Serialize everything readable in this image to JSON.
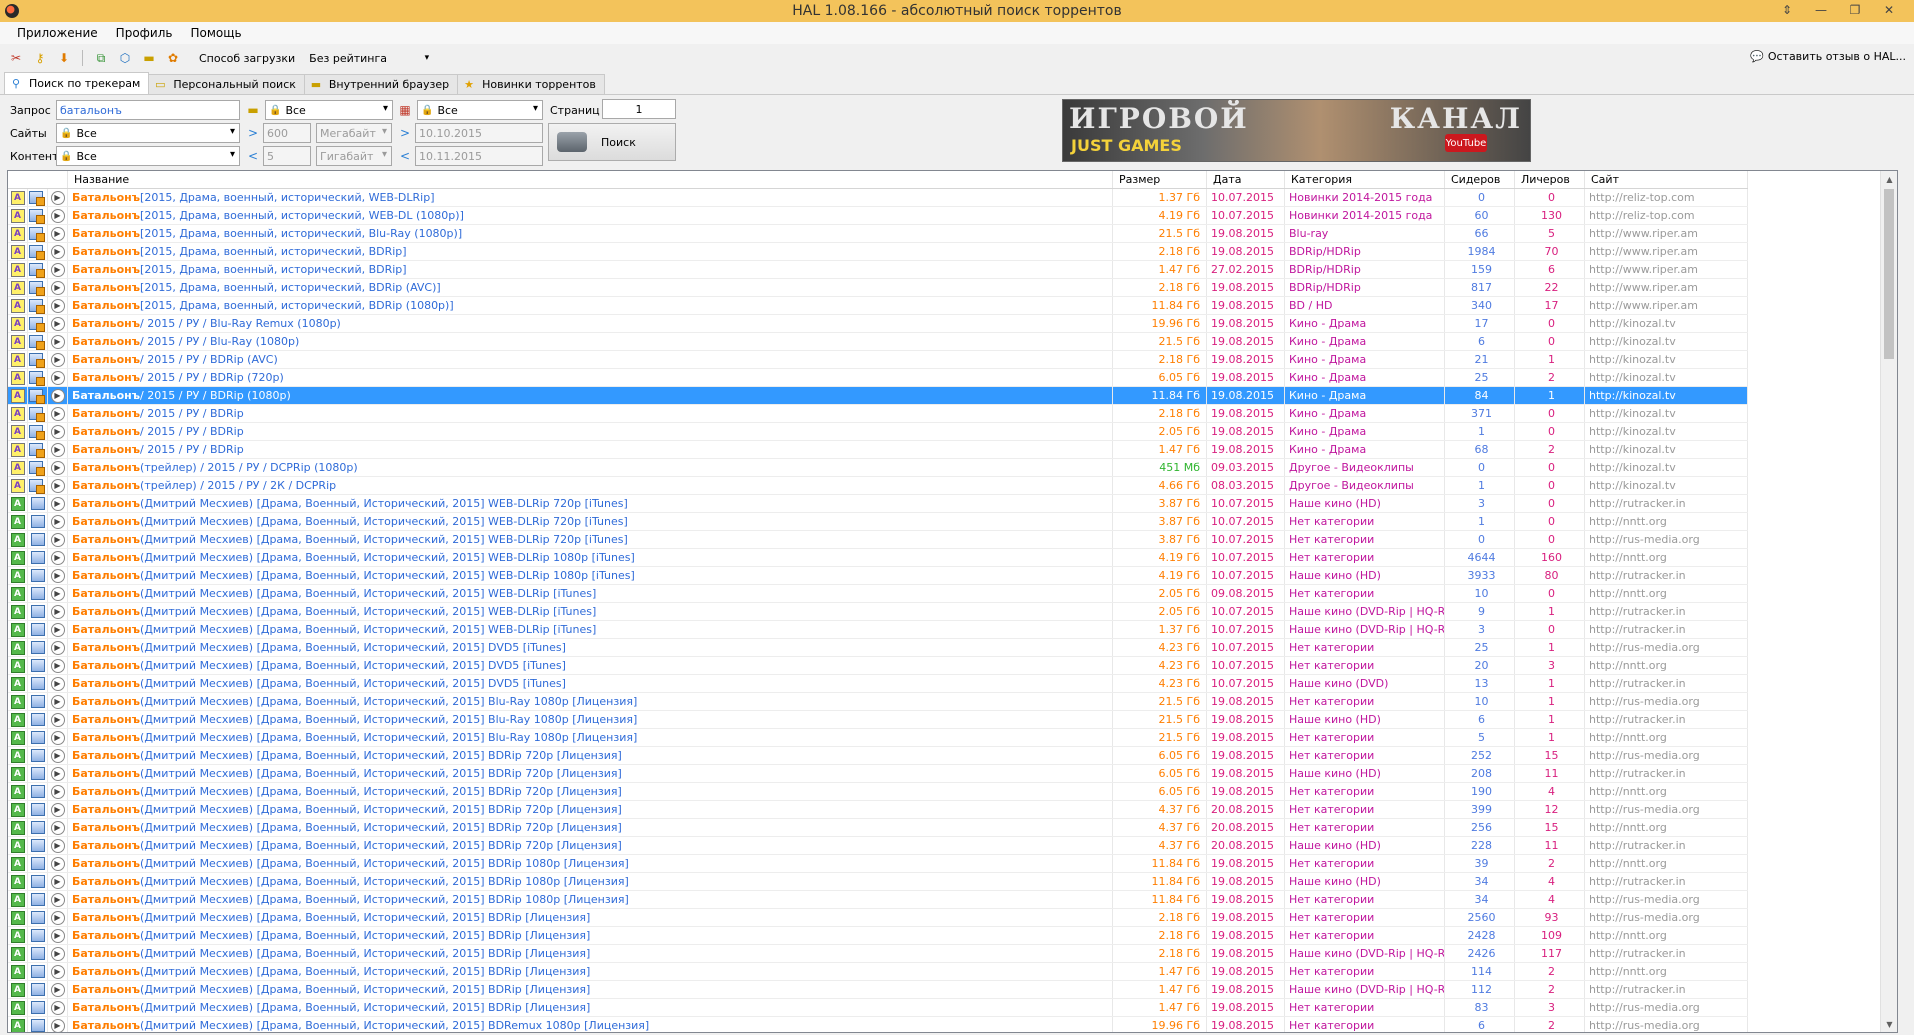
{
  "window": {
    "title": "HAL 1.08.166 - абсолютный поиск торрентов"
  },
  "menu": [
    "Приложение",
    "Профиль",
    "Помощь"
  ],
  "toolbar": {
    "download_method_label": "Способ загрузки",
    "rating_value": "Без рейтинга",
    "review_label": "Оставить отзыв о HAL..."
  },
  "tabs": [
    "Поиск по трекерам",
    "Персональный поиск",
    "Внутренний браузер",
    "Новинки торрентов"
  ],
  "search": {
    "query_label": "Запрос",
    "query_value": "батальонъ",
    "sites_label": "Сайты",
    "sites_value": "Все",
    "content_label": "Контент",
    "content_value": "Все",
    "filter1_value": "Все",
    "filter2_value": "Все",
    "size_min": "600",
    "size_min_unit": "Мегабайт",
    "size_max": "5",
    "size_max_unit": "Гигабайт",
    "date_from": "10.10.2015",
    "date_to": "10.11.2015",
    "pages_label": "Страниц",
    "pages_value": "1",
    "search_button": "Поиск"
  },
  "banner": {
    "line1": "ИГРОВОЙ",
    "line2": "КАНАЛ",
    "line3": "JUST GAMES",
    "badge": "YouTube"
  },
  "table": {
    "columns": [
      "Название",
      "Размер",
      "Дата",
      "Категория",
      "Сидеров",
      "Личеров",
      "Сайт"
    ],
    "rows": [
      {
        "type": "user",
        "q": "Батальонъ",
        "rest": " [2015, Драма, военный, исторический, WEB-DLRip]",
        "size": "1.37 Гб",
        "date": "10.07.2015",
        "cat": "Новинки 2014-2015 года",
        "seeds": "0",
        "leech": "0",
        "site": "http://reliz-top.com"
      },
      {
        "type": "user",
        "q": "Батальонъ",
        "rest": " [2015, Драма, военный, исторический, WEB-DL (1080p)]",
        "size": "4.19 Гб",
        "date": "10.07.2015",
        "cat": "Новинки 2014-2015 года",
        "seeds": "60",
        "leech": "130",
        "site": "http://reliz-top.com"
      },
      {
        "type": "user",
        "q": "Батальонъ",
        "rest": " [2015, Драма, военный, исторический, Blu-Ray (1080p)]",
        "size": "21.5 Гб",
        "date": "19.08.2015",
        "cat": "Blu-ray",
        "seeds": "66",
        "leech": "5",
        "site": "http://www.riper.am"
      },
      {
        "type": "user",
        "q": "Батальонъ",
        "rest": " [2015, Драма, военный, исторический, BDRip]",
        "size": "2.18 Гб",
        "date": "19.08.2015",
        "cat": "BDRip/HDRip",
        "seeds": "1984",
        "leech": "70",
        "site": "http://www.riper.am"
      },
      {
        "type": "user",
        "q": "Батальонъ",
        "rest": " [2015, Драма, военный, исторический, BDRip]",
        "size": "1.47 Гб",
        "date": "27.02.2015",
        "cat": "BDRip/HDRip",
        "seeds": "159",
        "leech": "6",
        "site": "http://www.riper.am"
      },
      {
        "type": "user",
        "q": "Батальонъ",
        "rest": " [2015, Драма, военный, исторический, BDRip (AVC)]",
        "size": "2.18 Гб",
        "date": "19.08.2015",
        "cat": "BDRip/HDRip",
        "seeds": "817",
        "leech": "22",
        "site": "http://www.riper.am"
      },
      {
        "type": "user",
        "q": "Батальонъ",
        "rest": " [2015, Драма, военный, исторический, BDRip (1080p)]",
        "size": "11.84 Гб",
        "date": "19.08.2015",
        "cat": "BD / HD",
        "seeds": "340",
        "leech": "17",
        "site": "http://www.riper.am"
      },
      {
        "type": "user",
        "q": "Батальонъ",
        "rest": " / 2015 / РУ / Blu-Ray Remux (1080p)",
        "size": "19.96 Гб",
        "date": "19.08.2015",
        "cat": "Кино - Драма",
        "seeds": "17",
        "leech": "0",
        "site": "http://kinozal.tv"
      },
      {
        "type": "user",
        "q": "Батальонъ",
        "rest": " / 2015 / РУ / Blu-Ray (1080p)",
        "size": "21.5 Гб",
        "date": "19.08.2015",
        "cat": "Кино - Драма",
        "seeds": "6",
        "leech": "0",
        "site": "http://kinozal.tv"
      },
      {
        "type": "user",
        "q": "Батальонъ",
        "rest": " / 2015 / РУ / BDRip (AVC)",
        "size": "2.18 Гб",
        "date": "19.08.2015",
        "cat": "Кино - Драма",
        "seeds": "21",
        "leech": "1",
        "site": "http://kinozal.tv"
      },
      {
        "type": "user",
        "q": "Батальонъ",
        "rest": " / 2015 / РУ / BDRip (720p)",
        "size": "6.05 Гб",
        "date": "19.08.2015",
        "cat": "Кино - Драма",
        "seeds": "25",
        "leech": "2",
        "site": "http://kinozal.tv"
      },
      {
        "type": "user",
        "sel": true,
        "q": "Батальонъ",
        "rest": " / 2015 / РУ / BDRip (1080p)",
        "size": "11.84 Гб",
        "date": "19.08.2015",
        "cat": "Кино - Драма",
        "seeds": "84",
        "leech": "1",
        "site": "http://kinozal.tv"
      },
      {
        "type": "user",
        "q": "Батальонъ",
        "rest": " / 2015 / РУ / BDRip",
        "size": "2.18 Гб",
        "date": "19.08.2015",
        "cat": "Кино - Драма",
        "seeds": "371",
        "leech": "0",
        "site": "http://kinozal.tv"
      },
      {
        "type": "user",
        "q": "Батальонъ",
        "rest": " / 2015 / РУ / BDRip",
        "size": "2.05 Гб",
        "date": "19.08.2015",
        "cat": "Кино - Драма",
        "seeds": "1",
        "leech": "0",
        "site": "http://kinozal.tv"
      },
      {
        "type": "user",
        "q": "Батальонъ",
        "rest": " / 2015 / РУ / BDRip",
        "size": "1.47 Гб",
        "date": "19.08.2015",
        "cat": "Кино - Драма",
        "seeds": "68",
        "leech": "2",
        "site": "http://kinozal.tv"
      },
      {
        "type": "user",
        "q": "Батальонъ",
        "rest": " (трейлер) / 2015 / РУ / DCPRip (1080p)",
        "size": "451 Мб",
        "green": true,
        "date": "09.03.2015",
        "cat": "Другое - Видеоклипы",
        "seeds": "0",
        "leech": "0",
        "site": "http://kinozal.tv"
      },
      {
        "type": "user",
        "q": "Батальонъ",
        "rest": " (трейлер) / 2015 / РУ / 2К / DCPRip",
        "size": "4.66 Гб",
        "date": "08.03.2015",
        "cat": "Другое - Видеоклипы",
        "seeds": "1",
        "leech": "0",
        "site": "http://kinozal.tv"
      },
      {
        "type": "green",
        "q": "Батальонъ",
        "rest": " (Дмитрий Месхиев) [Драма, Военный, Исторический, 2015] WEB-DLRip 720p [iTunes]",
        "size": "3.87 Гб",
        "date": "10.07.2015",
        "cat": "Наше кино (HD)",
        "seeds": "3",
        "leech": "0",
        "site": "http://rutracker.in"
      },
      {
        "type": "green",
        "q": "Батальонъ",
        "rest": " (Дмитрий Месхиев) [Драма, Военный, Исторический, 2015] WEB-DLRip 720p [iTunes]",
        "size": "3.87 Гб",
        "date": "10.07.2015",
        "cat": "Нет категории",
        "seeds": "1",
        "leech": "0",
        "site": "http://nntt.org"
      },
      {
        "type": "green",
        "q": "Батальонъ",
        "rest": " (Дмитрий Месхиев) [Драма, Военный, Исторический, 2015] WEB-DLRip 720p [iTunes]",
        "size": "3.87 Гб",
        "date": "10.07.2015",
        "cat": "Нет категории",
        "seeds": "0",
        "leech": "0",
        "site": "http://rus-media.org"
      },
      {
        "type": "green",
        "q": "Батальонъ",
        "rest": " (Дмитрий Месхиев) [Драма, Военный, Исторический, 2015] WEB-DLRip 1080p [iTunes]",
        "size": "4.19 Гб",
        "date": "10.07.2015",
        "cat": "Нет категории",
        "seeds": "4644",
        "leech": "160",
        "site": "http://nntt.org"
      },
      {
        "type": "green",
        "q": "Батальонъ",
        "rest": " (Дмитрий Месхиев) [Драма, Военный, Исторический, 2015] WEB-DLRip 1080p [iTunes]",
        "size": "4.19 Гб",
        "date": "10.07.2015",
        "cat": "Наше кино (HD)",
        "seeds": "3933",
        "leech": "80",
        "site": "http://rutracker.in"
      },
      {
        "type": "green",
        "q": "Батальонъ",
        "rest": " (Дмитрий Месхиев) [Драма, Военный, Исторический, 2015] WEB-DLRip [iTunes]",
        "size": "2.05 Гб",
        "date": "09.08.2015",
        "cat": "Нет категории",
        "seeds": "10",
        "leech": "0",
        "site": "http://nntt.org"
      },
      {
        "type": "green",
        "q": "Батальонъ",
        "rest": " (Дмитрий Месхиев) [Драма, Военный, Исторический, 2015] WEB-DLRip [iTunes]",
        "size": "2.05 Гб",
        "date": "10.07.2015",
        "cat": "Наше кино (DVD-Rip | HQ-Ri...",
        "seeds": "9",
        "leech": "1",
        "site": "http://rutracker.in"
      },
      {
        "type": "green",
        "q": "Батальонъ",
        "rest": " (Дмитрий Месхиев) [Драма, Военный, Исторический, 2015] WEB-DLRip [iTunes]",
        "size": "1.37 Гб",
        "date": "10.07.2015",
        "cat": "Наше кино (DVD-Rip | HQ-Ri...",
        "seeds": "3",
        "leech": "0",
        "site": "http://rutracker.in"
      },
      {
        "type": "green",
        "q": "Батальонъ",
        "rest": " (Дмитрий Месхиев) [Драма, Военный, Исторический, 2015] DVD5 [iTunes]",
        "size": "4.23 Гб",
        "date": "10.07.2015",
        "cat": "Нет категории",
        "seeds": "25",
        "leech": "1",
        "site": "http://rus-media.org"
      },
      {
        "type": "green",
        "q": "Батальонъ",
        "rest": " (Дмитрий Месхиев) [Драма, Военный, Исторический, 2015] DVD5 [iTunes]",
        "size": "4.23 Гб",
        "date": "10.07.2015",
        "cat": "Нет категории",
        "seeds": "20",
        "leech": "3",
        "site": "http://nntt.org"
      },
      {
        "type": "green",
        "q": "Батальонъ",
        "rest": " (Дмитрий Месхиев) [Драма, Военный, Исторический, 2015] DVD5 [iTunes]",
        "size": "4.23 Гб",
        "date": "10.07.2015",
        "cat": "Наше кино (DVD)",
        "seeds": "13",
        "leech": "1",
        "site": "http://rutracker.in"
      },
      {
        "type": "green",
        "q": "Батальонъ",
        "rest": " (Дмитрий Месхиев) [Драма, Военный, Исторический, 2015] Blu-Ray 1080p [Лицензия]",
        "size": "21.5 Гб",
        "date": "19.08.2015",
        "cat": "Нет категории",
        "seeds": "10",
        "leech": "1",
        "site": "http://rus-media.org"
      },
      {
        "type": "green",
        "q": "Батальонъ",
        "rest": " (Дмитрий Месхиев) [Драма, Военный, Исторический, 2015] Blu-Ray 1080p [Лицензия]",
        "size": "21.5 Гб",
        "date": "19.08.2015",
        "cat": "Наше кино (HD)",
        "seeds": "6",
        "leech": "1",
        "site": "http://rutracker.in"
      },
      {
        "type": "green",
        "q": "Батальонъ",
        "rest": " (Дмитрий Месхиев) [Драма, Военный, Исторический, 2015] Blu-Ray 1080p [Лицензия]",
        "size": "21.5 Гб",
        "date": "19.08.2015",
        "cat": "Нет категории",
        "seeds": "5",
        "leech": "1",
        "site": "http://nntt.org"
      },
      {
        "type": "green",
        "q": "Батальонъ",
        "rest": " (Дмитрий Месхиев) [Драма, Военный, Исторический, 2015] BDRip 720p [Лицензия]",
        "size": "6.05 Гб",
        "date": "19.08.2015",
        "cat": "Нет категории",
        "seeds": "252",
        "leech": "15",
        "site": "http://rus-media.org"
      },
      {
        "type": "green",
        "q": "Батальонъ",
        "rest": " (Дмитрий Месхиев) [Драма, Военный, Исторический, 2015] BDRip 720p [Лицензия]",
        "size": "6.05 Гб",
        "date": "19.08.2015",
        "cat": "Наше кино (HD)",
        "seeds": "208",
        "leech": "11",
        "site": "http://rutracker.in"
      },
      {
        "type": "green",
        "q": "Батальонъ",
        "rest": " (Дмитрий Месхиев) [Драма, Военный, Исторический, 2015] BDRip 720p [Лицензия]",
        "size": "6.05 Гб",
        "date": "19.08.2015",
        "cat": "Нет категории",
        "seeds": "190",
        "leech": "4",
        "site": "http://nntt.org"
      },
      {
        "type": "green",
        "q": "Батальонъ",
        "rest": " (Дмитрий Месхиев) [Драма, Военный, Исторический, 2015] BDRip 720p [Лицензия]",
        "size": "4.37 Гб",
        "date": "20.08.2015",
        "cat": "Нет категории",
        "seeds": "399",
        "leech": "12",
        "site": "http://rus-media.org"
      },
      {
        "type": "green",
        "q": "Батальонъ",
        "rest": " (Дмитрий Месхиев) [Драма, Военный, Исторический, 2015] BDRip 720p [Лицензия]",
        "size": "4.37 Гб",
        "date": "20.08.2015",
        "cat": "Нет категории",
        "seeds": "256",
        "leech": "15",
        "site": "http://nntt.org"
      },
      {
        "type": "green",
        "q": "Батальонъ",
        "rest": " (Дмитрий Месхиев) [Драма, Военный, Исторический, 2015] BDRip 720p [Лицензия]",
        "size": "4.37 Гб",
        "date": "20.08.2015",
        "cat": "Наше кино (HD)",
        "seeds": "228",
        "leech": "11",
        "site": "http://rutracker.in"
      },
      {
        "type": "green",
        "q": "Батальонъ",
        "rest": " (Дмитрий Месхиев) [Драма, Военный, Исторический, 2015] BDRip 1080p [Лицензия]",
        "size": "11.84 Гб",
        "date": "19.08.2015",
        "cat": "Нет категории",
        "seeds": "39",
        "leech": "2",
        "site": "http://nntt.org"
      },
      {
        "type": "green",
        "q": "Батальонъ",
        "rest": " (Дмитрий Месхиев) [Драма, Военный, Исторический, 2015] BDRip 1080p [Лицензия]",
        "size": "11.84 Гб",
        "date": "19.08.2015",
        "cat": "Наше кино (HD)",
        "seeds": "34",
        "leech": "4",
        "site": "http://rutracker.in"
      },
      {
        "type": "green",
        "q": "Батальонъ",
        "rest": " (Дмитрий Месхиев) [Драма, Военный, Исторический, 2015] BDRip 1080p [Лицензия]",
        "size": "11.84 Гб",
        "date": "19.08.2015",
        "cat": "Нет категории",
        "seeds": "34",
        "leech": "4",
        "site": "http://rus-media.org"
      },
      {
        "type": "green",
        "q": "Батальонъ",
        "rest": " (Дмитрий Месхиев) [Драма, Военный, Исторический, 2015] BDRip [Лицензия]",
        "size": "2.18 Гб",
        "date": "19.08.2015",
        "cat": "Нет категории",
        "seeds": "2560",
        "leech": "93",
        "site": "http://rus-media.org"
      },
      {
        "type": "green",
        "q": "Батальонъ",
        "rest": " (Дмитрий Месхиев) [Драма, Военный, Исторический, 2015] BDRip [Лицензия]",
        "size": "2.18 Гб",
        "date": "19.08.2015",
        "cat": "Нет категории",
        "seeds": "2428",
        "leech": "109",
        "site": "http://nntt.org"
      },
      {
        "type": "green",
        "q": "Батальонъ",
        "rest": " (Дмитрий Месхиев) [Драма, Военный, Исторический, 2015] BDRip [Лицензия]",
        "size": "2.18 Гб",
        "date": "19.08.2015",
        "cat": "Наше кино (DVD-Rip | HQ-Ri...",
        "seeds": "2426",
        "leech": "117",
        "site": "http://rutracker.in"
      },
      {
        "type": "green",
        "q": "Батальонъ",
        "rest": " (Дмитрий Месхиев) [Драма, Военный, Исторический, 2015] BDRip [Лицензия]",
        "size": "1.47 Гб",
        "date": "19.08.2015",
        "cat": "Нет категории",
        "seeds": "114",
        "leech": "2",
        "site": "http://nntt.org"
      },
      {
        "type": "green",
        "q": "Батальонъ",
        "rest": " (Дмитрий Месхиев) [Драма, Военный, Исторический, 2015] BDRip [Лицензия]",
        "size": "1.47 Гб",
        "date": "19.08.2015",
        "cat": "Наше кино (DVD-Rip | HQ-Ri...",
        "seeds": "112",
        "leech": "2",
        "site": "http://rutracker.in"
      },
      {
        "type": "green",
        "q": "Батальонъ",
        "rest": " (Дмитрий Месхиев) [Драма, Военный, Исторический, 2015] BDRip [Лицензия]",
        "size": "1.47 Гб",
        "date": "19.08.2015",
        "cat": "Нет категории",
        "seeds": "83",
        "leech": "3",
        "site": "http://rus-media.org"
      },
      {
        "type": "green",
        "q": "Батальонъ",
        "rest": " (Дмитрий Месхиев) [Драма, Военный, Исторический, 2015] BDRemux 1080p [Лицензия]",
        "size": "19.96 Гб",
        "date": "19.08.2015",
        "cat": "Нет категории",
        "seeds": "6",
        "leech": "2",
        "site": "http://rus-media.org"
      }
    ]
  }
}
